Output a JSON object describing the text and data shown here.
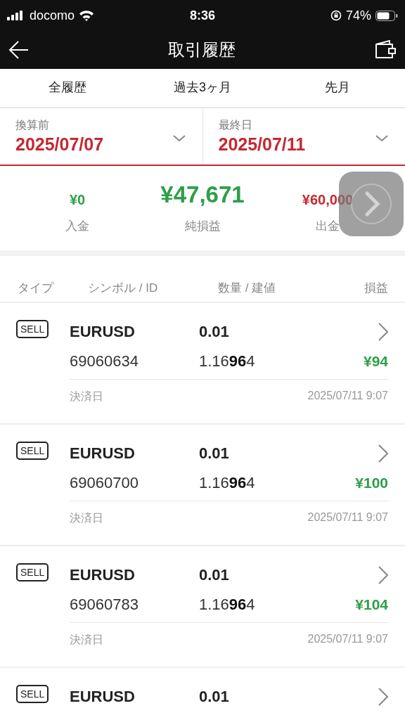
{
  "status_bar": {
    "carrier": "docomo",
    "time": "8:36",
    "battery": "74%"
  },
  "nav": {
    "title": "取引履歴"
  },
  "tabs": [
    {
      "label": "全履歴",
      "selected": false
    },
    {
      "label": "過去3ヶ月",
      "selected": false
    },
    {
      "label": "先月",
      "selected": false
    }
  ],
  "date_pickers": [
    {
      "label": "換算前",
      "value": "2025/07/07"
    },
    {
      "label": "最終日",
      "value": "2025/07/11"
    }
  ],
  "summary": [
    {
      "value": "¥0",
      "label": "入金",
      "color": "#2e9e4a",
      "emphasis": false
    },
    {
      "value": "¥47,671",
      "label": "純損益",
      "color": "#2e9e4a",
      "emphasis": true
    },
    {
      "value": "¥60,000",
      "label": "出金",
      "color": "#c62832",
      "emphasis": false
    }
  ],
  "table": {
    "columns": [
      "タイプ",
      "シンボル / ID",
      "数量 / 建値",
      "損益"
    ],
    "rows": [
      {
        "type": "SELL",
        "symbol": "EURUSD",
        "volume": "0.01",
        "id": "69060634",
        "price": "1.16**96**4",
        "profit": "¥94",
        "date_label": "決済日",
        "date": "2025/07/11 9:07"
      },
      {
        "type": "SELL",
        "symbol": "EURUSD",
        "volume": "0.01",
        "id": "69060700",
        "price": "1.16**96**4",
        "profit": "¥100",
        "date_label": "決済日",
        "date": "2025/07/11 9:07"
      },
      {
        "type": "SELL",
        "symbol": "EURUSD",
        "volume": "0.01",
        "id": "69060783",
        "price": "1.16**96**4",
        "profit": "¥104",
        "date_label": "決済日",
        "date": "2025/07/11 9:07"
      },
      {
        "type": "SELL",
        "symbol": "EURUSD",
        "volume": "0.01"
      }
    ]
  }
}
